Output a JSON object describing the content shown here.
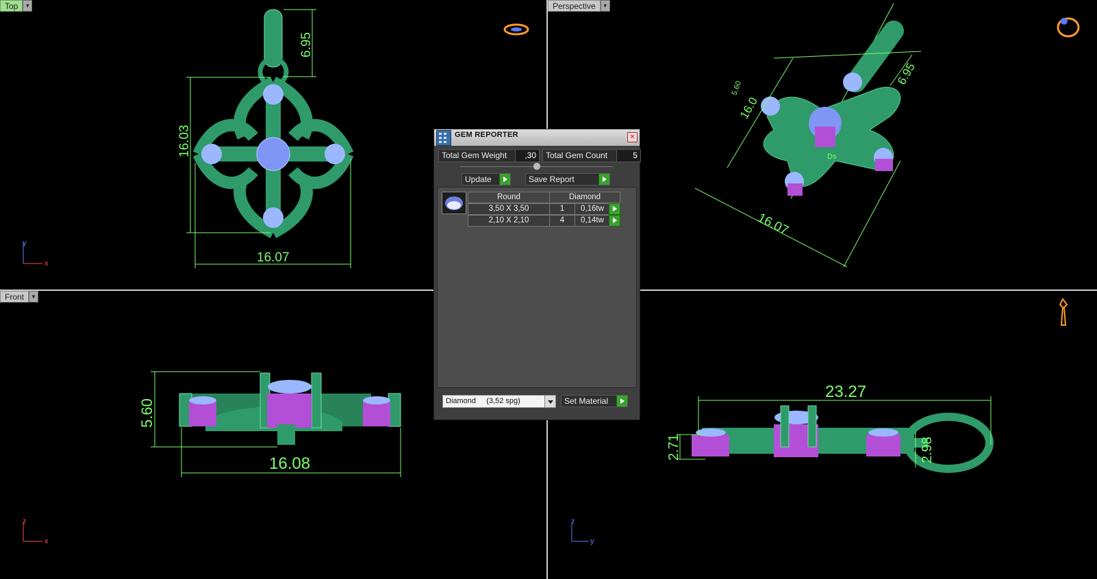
{
  "viewports": {
    "top": {
      "label": "Top",
      "dims": {
        "height": "16.03",
        "width": "16.07",
        "bail": "6.95"
      },
      "axes": {
        "h": "x",
        "v": "y"
      }
    },
    "perspective": {
      "label": "Perspective",
      "dims": {
        "height": "16.0",
        "width": "16.07",
        "bail": "6.95",
        "small": "5.60",
        "tiny": "Ds"
      }
    },
    "front": {
      "label": "Front",
      "dims": {
        "height": "5.60",
        "width": "16.08"
      },
      "axes": {
        "h": "x",
        "v": "z"
      }
    },
    "side": {
      "dims": {
        "width": "23.27",
        "height_left": "2.71",
        "loop": "2.98"
      },
      "axes": {
        "h": "y",
        "v": "z"
      }
    }
  },
  "dialog": {
    "title": "GEM REPORTER",
    "close": "×",
    "total_weight_label": "Total Gem Weight",
    "total_weight_value": ",30",
    "total_count_label": "Total Gem Count",
    "total_count_value": "5",
    "update_label": "Update",
    "save_label": "Save Report",
    "table": {
      "headers": [
        "Round",
        "Diamond"
      ],
      "rows": [
        {
          "size": "3,50 X 3,50",
          "count": "1",
          "weight": "0,16tw"
        },
        {
          "size": "2,10 X 2,10",
          "count": "4",
          "weight": "0,14tw"
        }
      ]
    },
    "material_select": "Diamond     (3,52 spg)",
    "set_material_label": "Set Material"
  },
  "colors": {
    "mesh": "#2f9a6a",
    "gem": "#9bb7ff",
    "dimension": "#7cff6a",
    "pink": "#c063e0"
  }
}
